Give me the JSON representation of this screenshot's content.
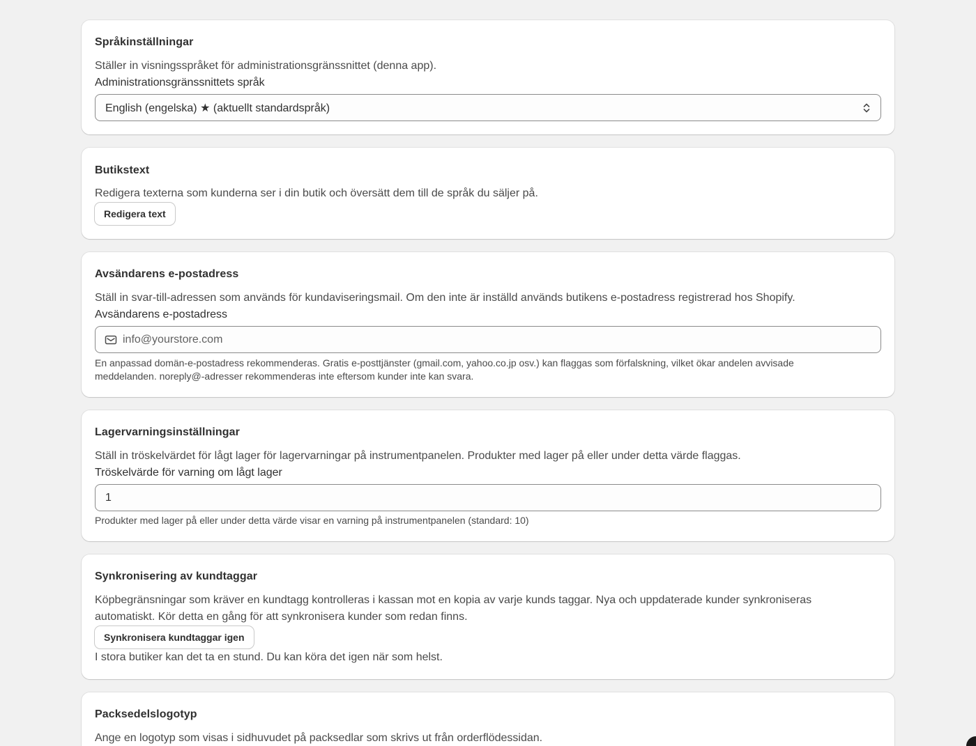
{
  "sections": {
    "language": {
      "title": "Språkinställningar",
      "description": "Ställer in visningsspråket för administrationsgränssnittet (denna app).",
      "field_label": "Administrationsgränssnittets språk",
      "selected_value": "English (engelska) ★ (aktuellt standardspråk)"
    },
    "store_text": {
      "title": "Butikstext",
      "description": "Redigera texterna som kunderna ser i din butik och översätt dem till de språk du säljer på.",
      "button_label": "Redigera text"
    },
    "sender_email": {
      "title": "Avsändarens e-postadress",
      "description": "Ställ in svar-till-adressen som används för kundaviseringsmail. Om den inte är inställd används butikens e-postadress registrerad hos Shopify.",
      "field_label": "Avsändarens e-postadress",
      "placeholder": "info@yourstore.com",
      "icon": "mail-icon",
      "help_line1": "En anpassad domän-e-postadress rekommenderas. Gratis e-posttjänster (gmail.com, yahoo.co.jp osv.) kan flaggas som förfalskning, vilket ökar andelen avvisade",
      "help_line2": "meddelanden. noreply@-adresser rekommenderas inte eftersom kunder inte kan svara."
    },
    "stock_alert": {
      "title": "Lagervarningsinställningar",
      "description": "Ställ in tröskelvärdet för lågt lager för lagervarningar på instrumentpanelen. Produkter med lager på eller under detta värde flaggas.",
      "field_label": "Tröskelvärde för varning om lågt lager",
      "value": "1",
      "help": "Produkter med lager på eller under detta värde visar en varning på instrumentpanelen (standard: 10)"
    },
    "tag_sync": {
      "title": "Synkronisering av kundtaggar",
      "description_line1": "Köpbegränsningar som kräver en kundtagg kontrolleras i kassan mot en kopia av varje kunds taggar. Nya och uppdaterade kunder synkroniseras",
      "description_line2": "automatiskt. Kör detta en gång för att synkronisera kunder som redan finns.",
      "button_label": "Synkronisera kundtaggar igen",
      "note": "I stora butiker kan det ta en stund. Du kan köra det igen när som helst."
    },
    "packing_logo": {
      "title": "Packsedelslogotyp",
      "description": "Ange en logotyp som visas i sidhuvudet på packsedlar som skrivs ut från orderflödessidan."
    }
  }
}
